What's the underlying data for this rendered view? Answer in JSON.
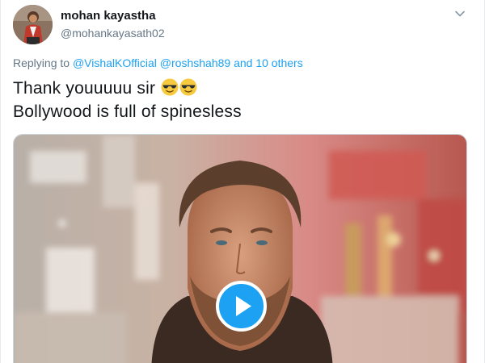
{
  "tweet": {
    "author": {
      "display_name": "mohan kayastha",
      "handle": "@mohankayasath02",
      "avatar_icon": "profile-photo"
    },
    "reply": {
      "prefix": "Replying to",
      "mentions": [
        "@VishalKOfficial",
        "@roshshah89"
      ],
      "connector": "and",
      "others": "10 others"
    },
    "text_lines": [
      "Thank youuuuu sir",
      "Bollywood is full of spinesless"
    ],
    "text_emoji": [
      "smiling-face-with-sunglasses",
      "smiling-face-with-sunglasses"
    ],
    "media": {
      "type": "gif",
      "play_icon": "play-icon"
    },
    "menu_icon": "chevron-down-icon"
  },
  "colors": {
    "link": "#1da1f2",
    "secondary_text": "#657786",
    "primary_text": "#14171a",
    "play_button": "#1da1f2"
  }
}
